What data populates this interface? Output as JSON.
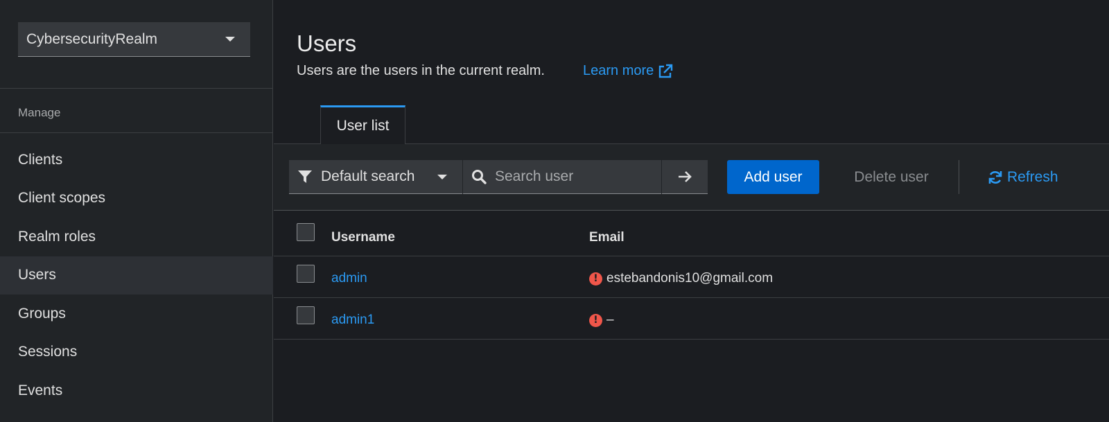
{
  "sidebar": {
    "realm": "CybersecurityRealm",
    "section_label": "Manage",
    "items": [
      {
        "label": "Clients"
      },
      {
        "label": "Client scopes"
      },
      {
        "label": "Realm roles"
      },
      {
        "label": "Users",
        "active": true
      },
      {
        "label": "Groups"
      },
      {
        "label": "Sessions"
      },
      {
        "label": "Events"
      }
    ]
  },
  "header": {
    "title": "Users",
    "description": "Users are the users in the current realm.",
    "learn_more": "Learn more"
  },
  "tabs": [
    {
      "label": "User list",
      "active": true
    }
  ],
  "toolbar": {
    "filter_label": "Default search",
    "search_placeholder": "Search user",
    "search_value": "",
    "add_label": "Add user",
    "delete_label": "Delete user",
    "refresh_label": "Refresh"
  },
  "table": {
    "columns": [
      "Username",
      "Email"
    ],
    "rows": [
      {
        "username": "admin",
        "email": "estebandonis10@gmail.com",
        "email_warning": true
      },
      {
        "username": "admin1",
        "email": "–",
        "email_warning": true
      }
    ]
  },
  "colors": {
    "accent": "#2b9af3",
    "primary_button": "#0066cc",
    "warning": "#f0564a",
    "background": "#1b1d21"
  },
  "icons": {
    "realm_caret": "caret-down-icon",
    "learn_more": "external-link-icon",
    "filter": "filter-icon",
    "search": "search-icon",
    "search_go": "arrow-right-icon",
    "refresh": "refresh-icon",
    "email_warning": "exclamation-circle-icon"
  }
}
